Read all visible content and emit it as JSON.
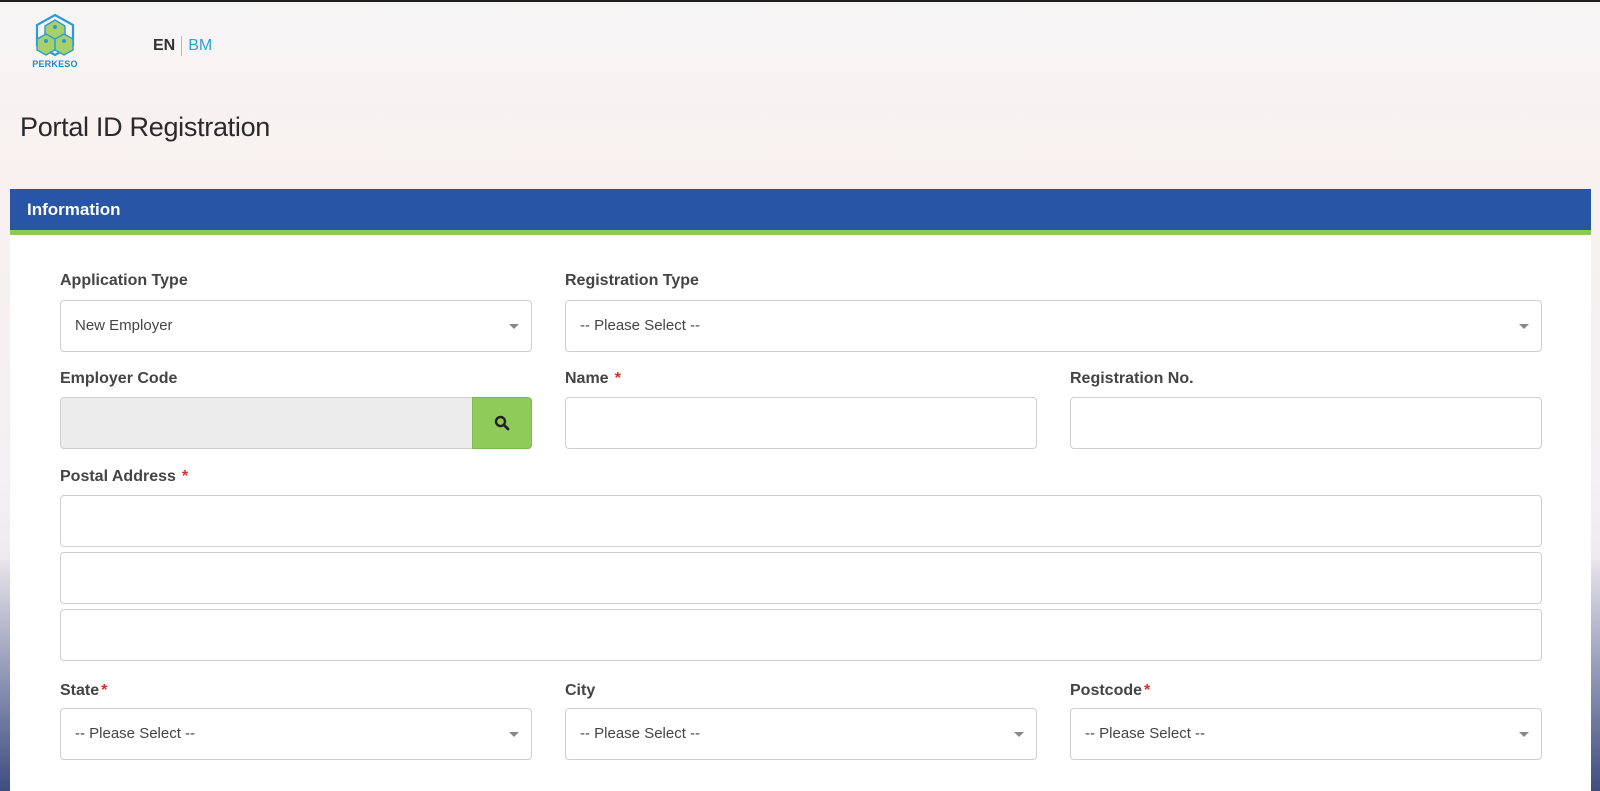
{
  "logo": {
    "text": "PERKESO"
  },
  "language": {
    "active": "EN",
    "other": "BM"
  },
  "page": {
    "title": "Portal ID Registration"
  },
  "panel": {
    "title": "Information"
  },
  "form": {
    "application_type": {
      "label": "Application Type",
      "value": "New Employer"
    },
    "registration_type": {
      "label": "Registration Type",
      "value": "-- Please Select --"
    },
    "employer_code": {
      "label": "Employer Code",
      "value": ""
    },
    "name": {
      "label": "Name",
      "required_mark": "*",
      "value": ""
    },
    "registration_no": {
      "label": "Registration No.",
      "value": ""
    },
    "postal_address": {
      "label": "Postal Address",
      "required_mark": "*",
      "lines": [
        "",
        "",
        ""
      ]
    },
    "state": {
      "label": "State",
      "required_mark": "*",
      "value": "-- Please Select --"
    },
    "city": {
      "label": "City",
      "value": "-- Please Select --"
    },
    "postcode": {
      "label": "Postcode",
      "required_mark": "*",
      "value": "-- Please Select --"
    }
  },
  "colors": {
    "header_blue": "#2855a6",
    "accent_green": "#8dc85b",
    "button_green": "#8ecb59",
    "required_red": "#e02b2b",
    "link_blue": "#2ba4d9"
  },
  "icons": {
    "logo": "perkeso-hexagon-logo-icon",
    "search": "search-icon",
    "caret": "chevron-down-icon"
  }
}
